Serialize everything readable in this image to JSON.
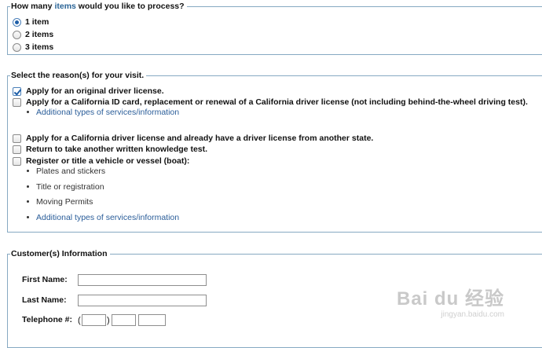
{
  "items_section": {
    "legend_prefix": "How many ",
    "legend_highlight": "items",
    "legend_suffix": " would you like to process?",
    "options": [
      "1 item",
      "2 items",
      "3 items"
    ],
    "selected_index": 0
  },
  "reasons_section": {
    "legend": "Select the reason(s) for your visit.",
    "reason1": "Apply for an original driver license.",
    "reason1_checked": true,
    "reason2": "Apply for a California ID card, replacement or renewal of a California driver license (not including behind-the-wheel driving test).",
    "reason2_link": "Additional types of services/information",
    "reason3": "Apply for a California driver license and already have a driver license from another state.",
    "reason4": "Return to take another written knowledge test.",
    "reason5": "Register or title a vehicle or vessel (boat):",
    "reason5_sub": [
      "Plates and stickers",
      "Title or registration",
      "Moving Permits"
    ],
    "reason5_link": "Additional types of services/information"
  },
  "customer_section": {
    "legend": "Customer(s) Information",
    "first_name_label": "First Name:",
    "first_name_value": "",
    "last_name_label": "Last Name:",
    "last_name_value": "",
    "telephone_label": "Telephone #:",
    "paren_open": "(",
    "paren_close": ")"
  },
  "watermark": {
    "main": "Bai du 经验",
    "sub": "jingyan.baidu.com"
  }
}
